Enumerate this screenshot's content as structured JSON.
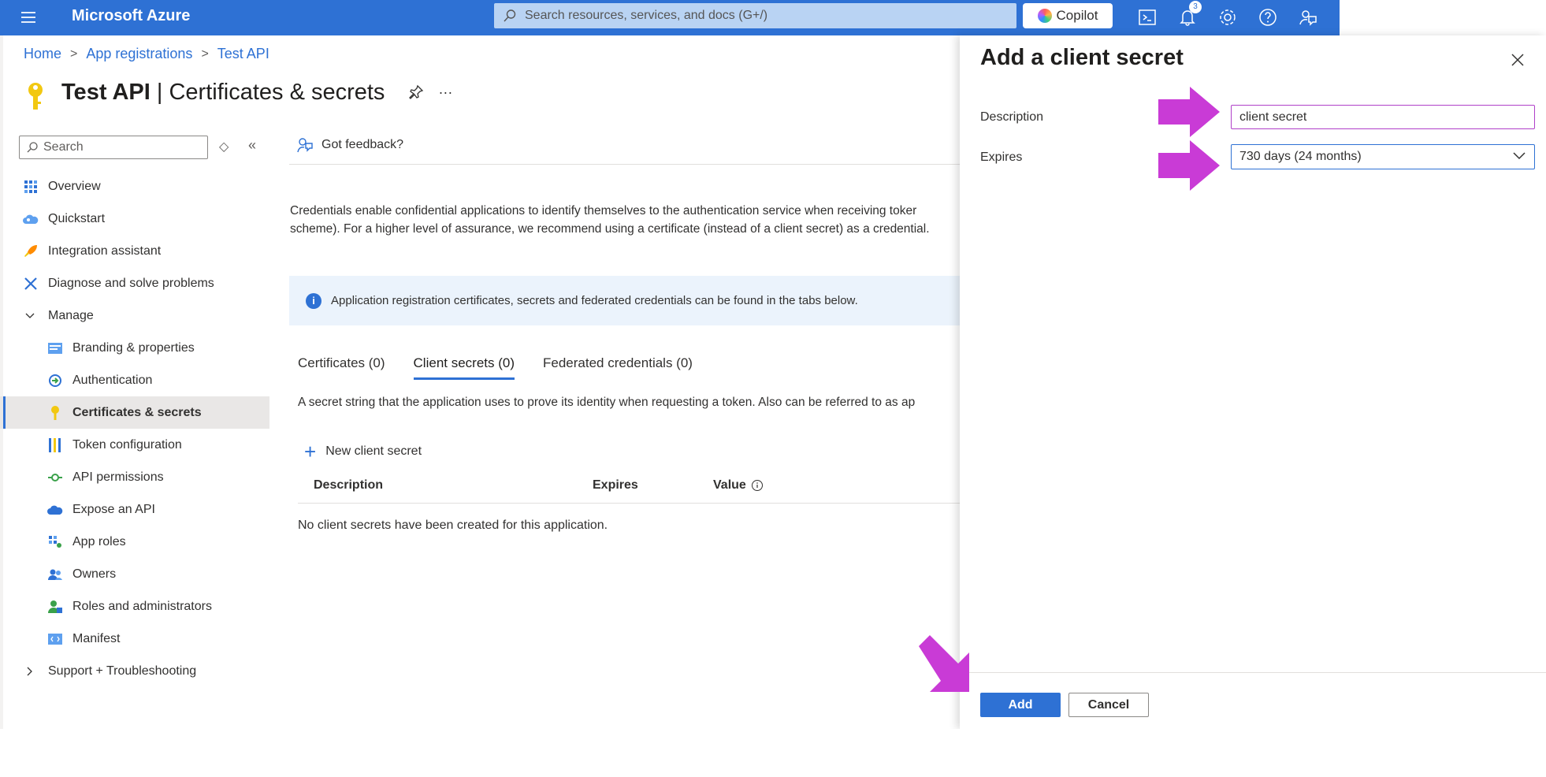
{
  "topbar": {
    "brand": "Microsoft Azure",
    "search_placeholder": "Search resources, services, and docs (G+/)",
    "copilot_label": "Copilot",
    "notification_count": "3"
  },
  "breadcrumb": {
    "items": [
      "Home",
      "App registrations",
      "Test API"
    ]
  },
  "page": {
    "title_bold": "Test API",
    "title_rest": "| Certificates & secrets",
    "more": "···"
  },
  "sidebar": {
    "search_placeholder": "Search",
    "items": [
      {
        "label": "Overview",
        "icon": "grid-icon"
      },
      {
        "label": "Quickstart",
        "icon": "cloud-users-icon"
      },
      {
        "label": "Integration assistant",
        "icon": "rocket-icon"
      },
      {
        "label": "Diagnose and solve problems",
        "icon": "wrench-icon"
      },
      {
        "label": "Manage",
        "icon": "chevron-down-icon"
      },
      {
        "label": "Branding & properties",
        "icon": "branding-icon"
      },
      {
        "label": "Authentication",
        "icon": "authentication-icon"
      },
      {
        "label": "Certificates & secrets",
        "icon": "key-icon"
      },
      {
        "label": "Token configuration",
        "icon": "token-icon"
      },
      {
        "label": "API permissions",
        "icon": "api-permissions-icon"
      },
      {
        "label": "Expose an API",
        "icon": "cloud-icon"
      },
      {
        "label": "App roles",
        "icon": "app-roles-icon"
      },
      {
        "label": "Owners",
        "icon": "owners-icon"
      },
      {
        "label": "Roles and administrators",
        "icon": "roles-admin-icon"
      },
      {
        "label": "Manifest",
        "icon": "manifest-icon"
      },
      {
        "label": "Support + Troubleshooting",
        "icon": "chevron-right-icon"
      }
    ]
  },
  "main": {
    "feedback": "Got feedback?",
    "intro_line1": "Credentials enable confidential applications to identify themselves to the authentication service when receiving toker",
    "intro_line2": "scheme). For a higher level of assurance, we recommend using a certificate (instead of a client secret) as a credential.",
    "info": "Application registration certificates, secrets and federated credentials can be found in the tabs below.",
    "tabs": [
      "Certificates (0)",
      "Client secrets (0)",
      "Federated credentials (0)"
    ],
    "tab_description": "A secret string that the application uses to prove its identity when requesting a token. Also can be referred to as ap",
    "new_secret": "New client secret",
    "columns": [
      "Description",
      "Expires",
      "Value"
    ],
    "empty": "No client secrets have been created for this application."
  },
  "panel": {
    "title": "Add a client secret",
    "description_label": "Description",
    "description_value": "client secret",
    "expires_label": "Expires",
    "expires_value": "730 days (24 months)",
    "add": "Add",
    "cancel": "Cancel"
  },
  "colors": {
    "accent": "#2e71d4",
    "annotation_arrow": "#c93bd6"
  }
}
